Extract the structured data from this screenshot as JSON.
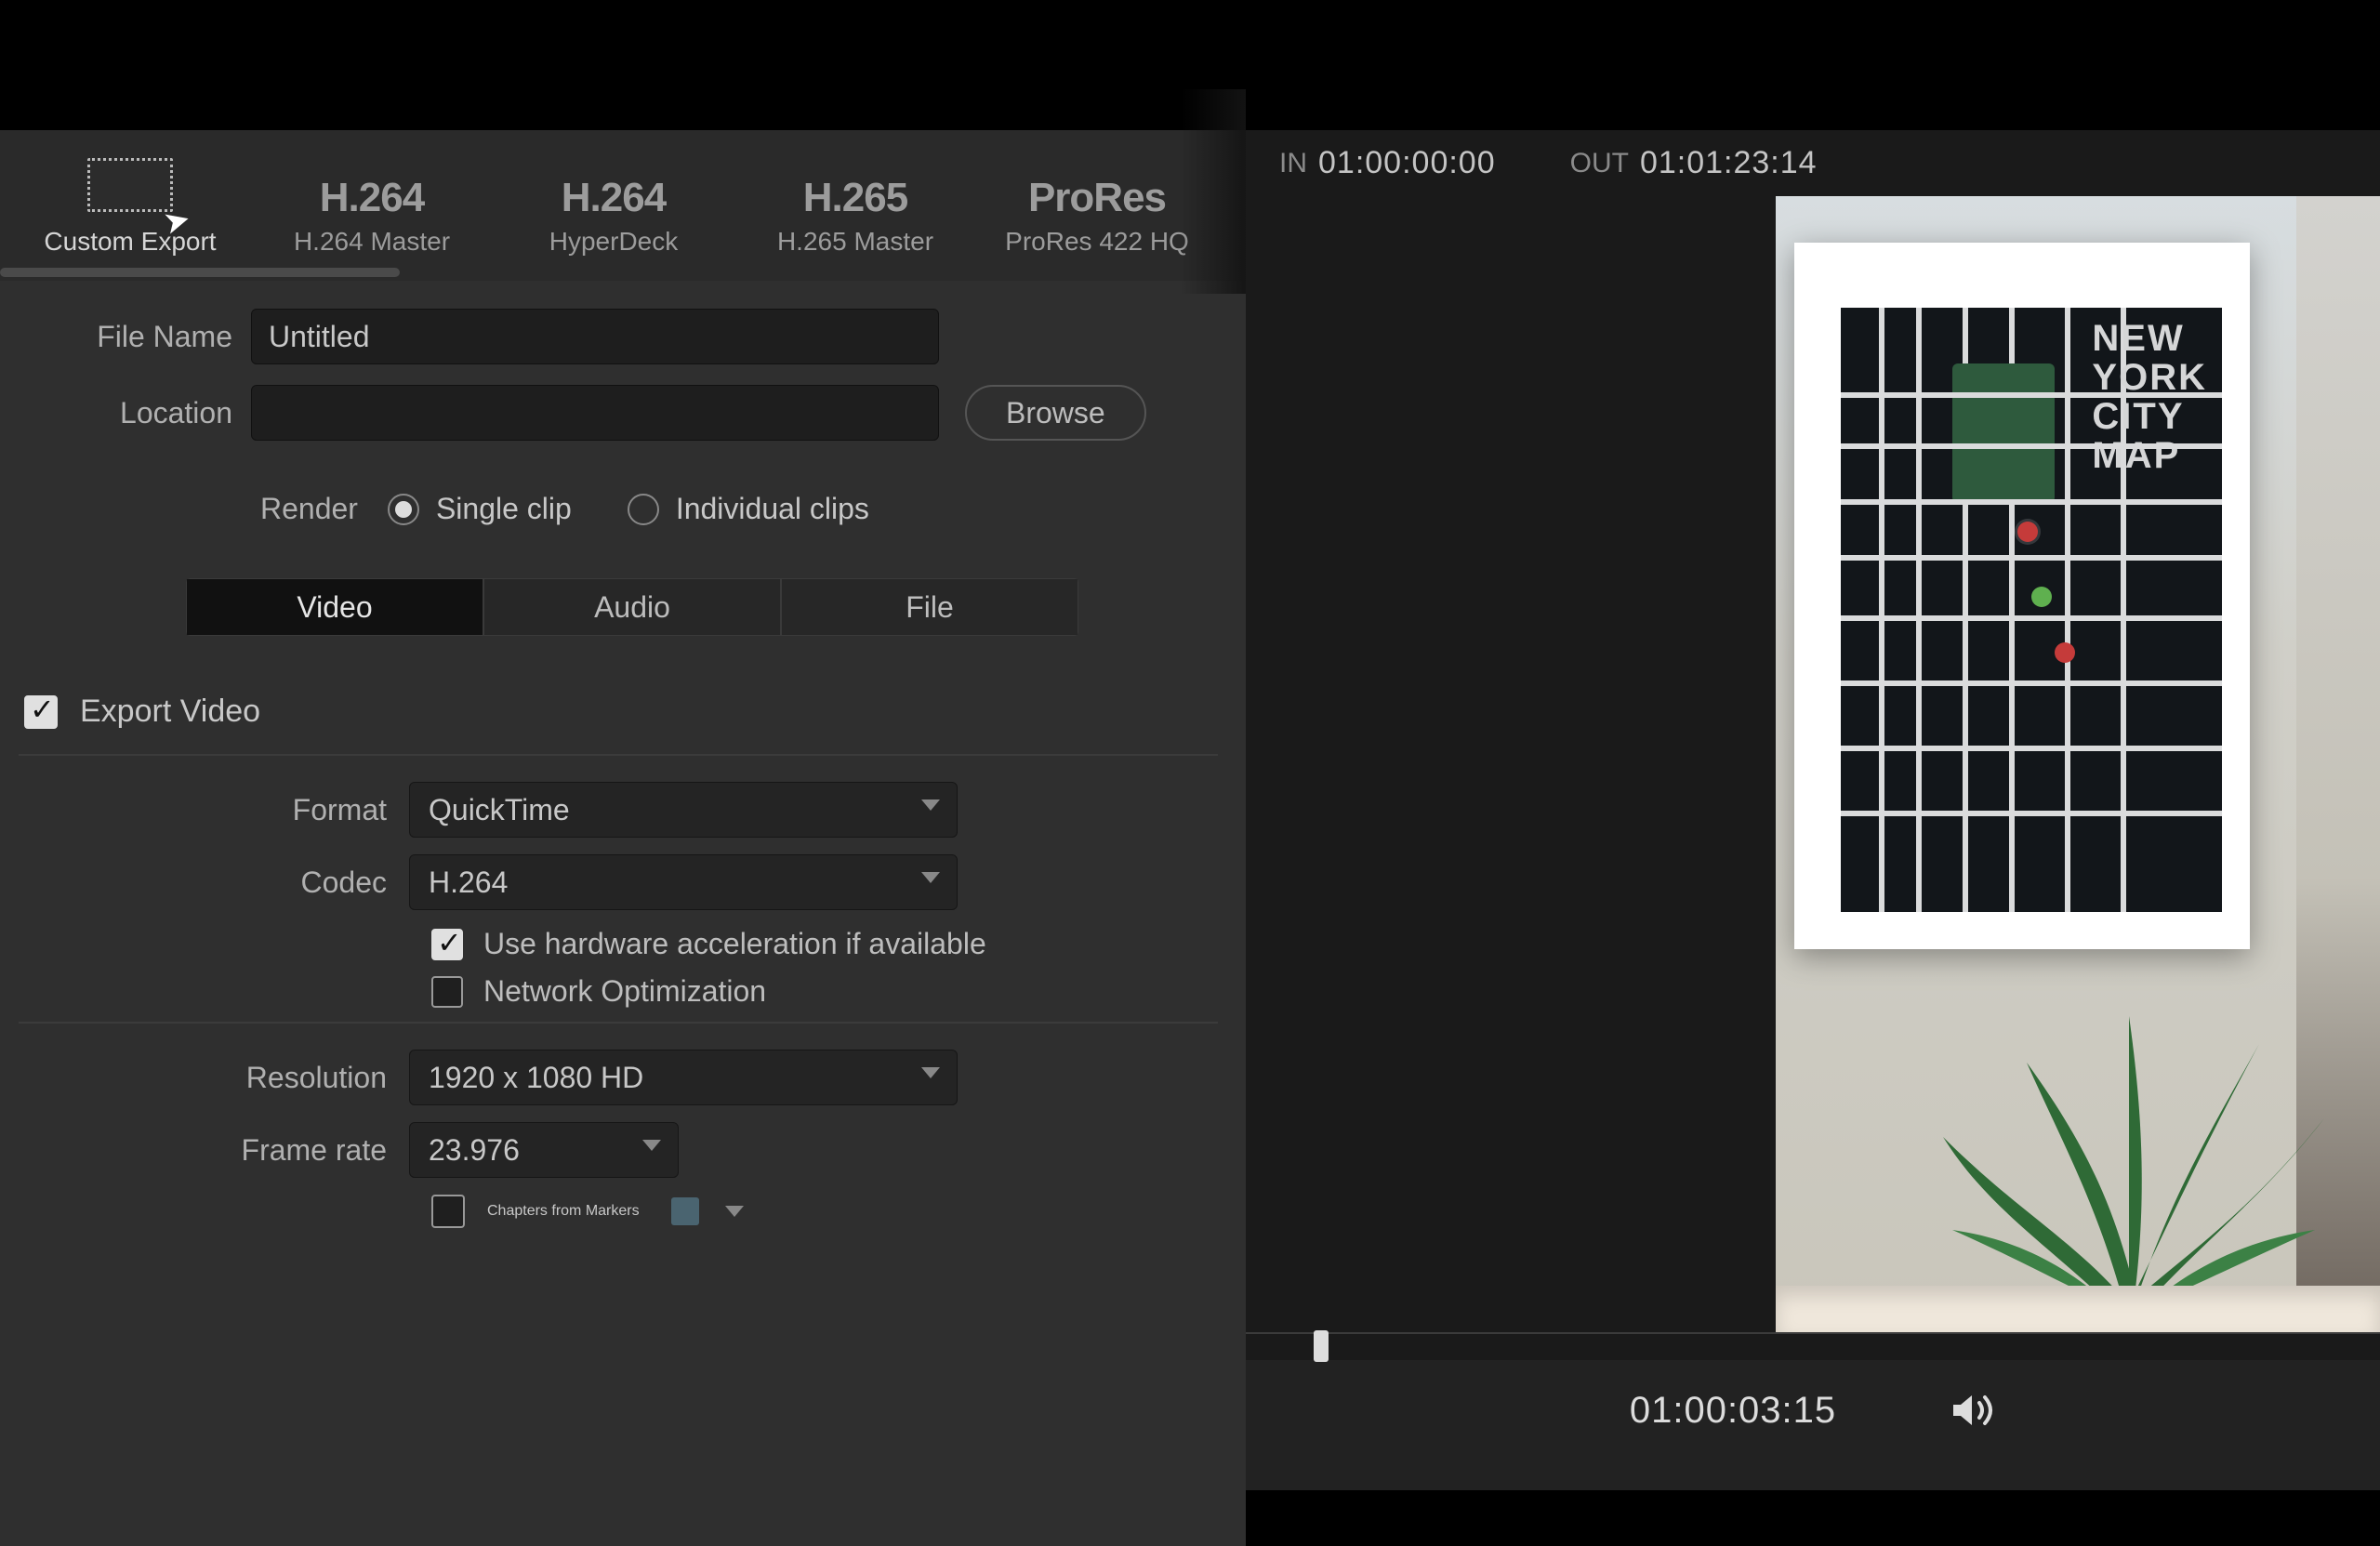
{
  "presets": [
    {
      "id": "custom",
      "title": "",
      "subtitle": "Custom Export",
      "active": true
    },
    {
      "id": "h264-master",
      "title": "H.264",
      "subtitle": "H.264 Master",
      "active": false
    },
    {
      "id": "hyperdeck",
      "title": "H.264",
      "subtitle": "HyperDeck",
      "active": false
    },
    {
      "id": "h265-master",
      "title": "H.265",
      "subtitle": "H.265 Master",
      "active": false
    },
    {
      "id": "prores-hq",
      "title": "ProRes",
      "subtitle": "ProRes 422 HQ",
      "active": false
    }
  ],
  "file": {
    "name_label": "File Name",
    "name_value": "Untitled",
    "location_label": "Location",
    "location_value": "",
    "browse_label": "Browse"
  },
  "render": {
    "label": "Render",
    "single_clip": "Single clip",
    "individual_clips": "Individual clips",
    "selected": "single"
  },
  "tabs": {
    "video": "Video",
    "audio": "Audio",
    "file": "File",
    "active": "video"
  },
  "export_video": {
    "checkbox_label": "Export Video",
    "checked": true
  },
  "settings": {
    "format_label": "Format",
    "format_value": "QuickTime",
    "codec_label": "Codec",
    "codec_value": "H.264",
    "hw_accel_label": "Use hardware acceleration if available",
    "hw_accel_checked": true,
    "net_opt_label": "Network Optimization",
    "net_opt_checked": false,
    "resolution_label": "Resolution",
    "resolution_value": "1920 x 1080 HD",
    "framerate_label": "Frame rate",
    "framerate_value": "23.976",
    "chapters_label": "Chapters from Markers",
    "chapters_checked": false,
    "marker_color": "#4a6470"
  },
  "timecode": {
    "in_label": "IN",
    "in_value": "01:00:00:00",
    "out_label": "OUT",
    "out_value": "01:01:23:14",
    "current": "01:00:03:15",
    "playhead_percent": 6
  },
  "preview_art": {
    "map_title_lines": [
      "NEW",
      "YORK",
      "CITY",
      "MAP"
    ]
  }
}
